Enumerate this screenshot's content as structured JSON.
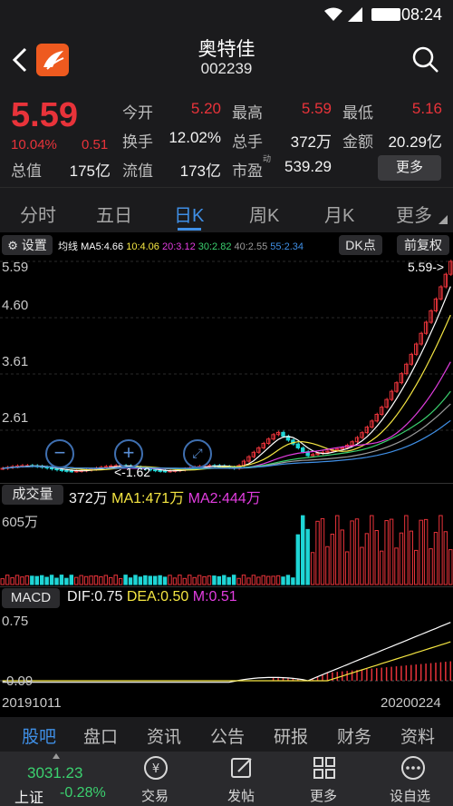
{
  "status_bar": {
    "time": "08:24"
  },
  "header": {
    "name": "奥特佳",
    "code": "002239"
  },
  "quote": {
    "price": "5.59",
    "change_pct": "10.04%",
    "change": "0.51",
    "stats": [
      {
        "label": "今开",
        "value": "5.20",
        "color": "red"
      },
      {
        "label": "最高",
        "value": "5.59",
        "color": "red"
      },
      {
        "label": "最低",
        "value": "5.16",
        "color": "red"
      },
      {
        "label": "换手",
        "value": "12.02%",
        "color": "white"
      },
      {
        "label": "总手",
        "value": "372万",
        "color": "white"
      },
      {
        "label": "金额",
        "value": "20.29亿",
        "color": "white"
      },
      {
        "label": "总值",
        "value": "175亿",
        "color": "white"
      },
      {
        "label": "流值",
        "value": "173亿",
        "color": "white"
      },
      {
        "label": "市盈",
        "value": "539.29",
        "color": "white"
      }
    ],
    "pe_superscript": "动",
    "more_label": "更多"
  },
  "tabs": [
    "分时",
    "五日",
    "日K",
    "周K",
    "月K",
    "更多"
  ],
  "active_tab": "日K",
  "chart": {
    "settings_label": "设置",
    "ma_label": "均线",
    "ma_values": [
      {
        "text": "MA5:4.66",
        "color": "#ffffff"
      },
      {
        "text": "10:4.06",
        "color": "#f5e642"
      },
      {
        "text": "20:3.12",
        "color": "#e23de0"
      },
      {
        "text": "30:2.82",
        "color": "#3bd16f"
      },
      {
        "text": "40:2.55",
        "color": "#9b9b9b"
      },
      {
        "text": "55:2.34",
        "color": "#3f8fe6"
      }
    ],
    "dk_button": "DK点",
    "adjust_button": "前复权",
    "price_axis": [
      "5.59",
      "4.60",
      "3.61",
      "2.61"
    ],
    "high_marker": "5.59->",
    "low_marker": "<-1.62",
    "volume_label": "成交量",
    "volume_value": "372万",
    "volume_ma1": "MA1:471万",
    "volume_ma2": "MA2:444万",
    "volume_axis": "605万",
    "macd_label": "MACD",
    "dif": "DIF:0.75",
    "dea": "DEA:0.50",
    "m": "M:0.51",
    "macd_axis_top": "0.75",
    "macd_axis_bottom": "-0.09",
    "date_start": "20191011",
    "date_end": "20200224"
  },
  "bottom_tabs": [
    "股吧",
    "盘口",
    "资讯",
    "公告",
    "研报",
    "财务",
    "资料"
  ],
  "active_bottom_tab": "股吧",
  "index": {
    "name": "上证",
    "value": "3031.23",
    "change": "-0.28%"
  },
  "toolbar": [
    "交易",
    "发帖",
    "更多",
    "设自选"
  ]
}
